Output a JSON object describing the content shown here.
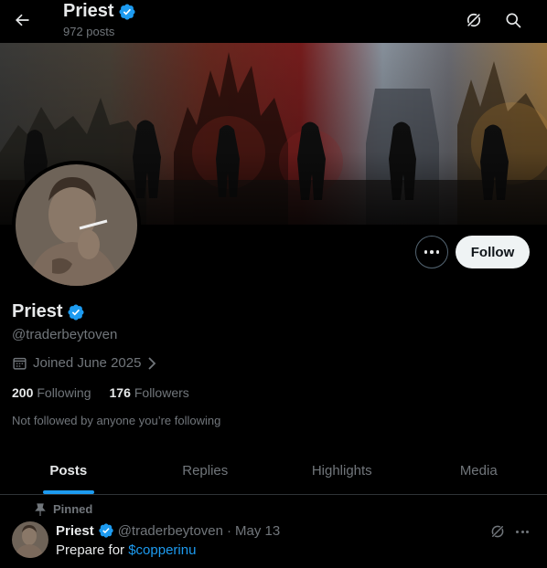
{
  "header": {
    "name": "Priest",
    "post_count": "972 posts",
    "icons": [
      "back-arrow-icon",
      "grok-icon",
      "search-icon"
    ]
  },
  "profile": {
    "name": "Priest",
    "handle": "@traderbeytoven",
    "joined": "Joined June 2025",
    "following_count": "200",
    "following_label": "Following",
    "followers_count": "176",
    "followers_label": "Followers",
    "note": "Not followed by anyone you’re following",
    "follow_label": "Follow",
    "verified": true
  },
  "tabs": [
    {
      "label": "Posts",
      "active": true
    },
    {
      "label": "Replies",
      "active": false
    },
    {
      "label": "Highlights",
      "active": false
    },
    {
      "label": "Media",
      "active": false
    }
  ],
  "post": {
    "pinned_label": "Pinned",
    "author": "Priest",
    "handle": "@traderbeytoven",
    "separator": "·",
    "date": "May 13",
    "text_prefix": "Prepare for ",
    "cashtag": "$copperinu"
  },
  "colors": {
    "background": "#000000",
    "accent": "#1d9bf0",
    "text_primary": "#e7e9ea",
    "text_secondary": "#71767b",
    "follow_button_bg": "#eff3f4"
  }
}
